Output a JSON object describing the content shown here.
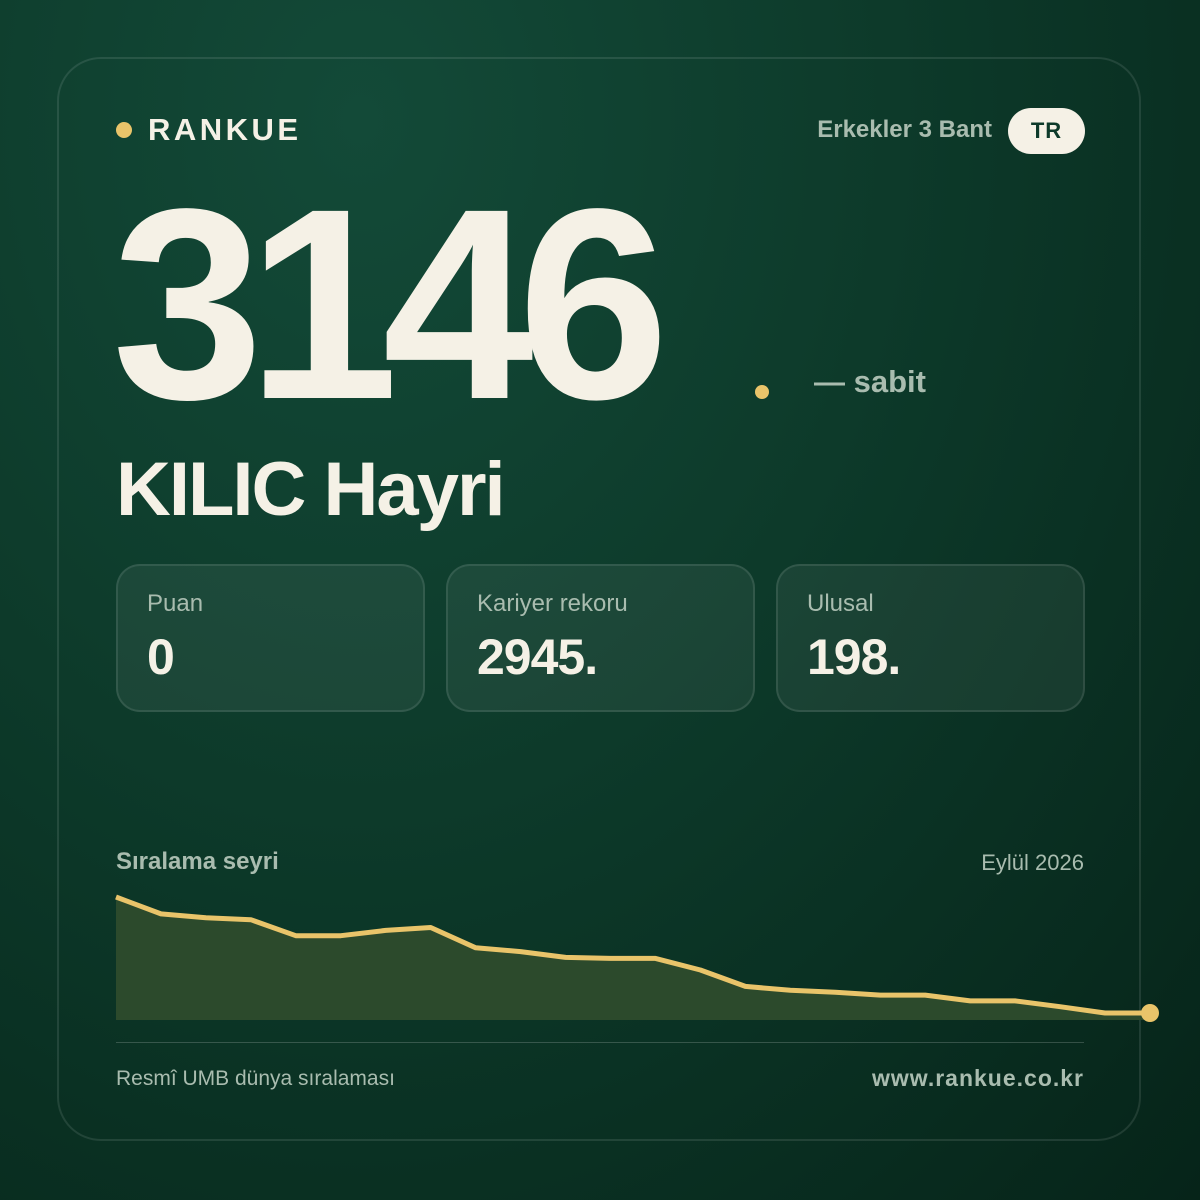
{
  "brand": {
    "name": "RANKUE",
    "dot_color": "#e9c46a"
  },
  "header": {
    "category": "Erkekler 3 Bant",
    "country": "TR"
  },
  "player": {
    "rank": "3146",
    "trend": "— sabit",
    "name": "KILIC Hayri"
  },
  "stats": [
    {
      "label": "Puan",
      "value": "0"
    },
    {
      "label": "Kariyer rekoru",
      "value": "2945."
    },
    {
      "label": "Ulusal",
      "value": "198."
    }
  ],
  "chart": {
    "title": "Sıralama seyri",
    "date": "Eylül 2026"
  },
  "chart_data": {
    "type": "area",
    "title": "Sıralama seyri",
    "series": [
      {
        "values": [
          2945,
          2980,
          2988,
          2992,
          3025,
          3025,
          3014,
          3008,
          3050,
          3058,
          3070,
          3072,
          3072,
          3096,
          3130,
          3138,
          3142,
          3148,
          3148,
          3160,
          3160,
          3172,
          3185,
          3185
        ]
      }
    ],
    "y_inverted": true,
    "line_color": "#e9c46a",
    "fill_color": "#2c4a2c",
    "grid": false,
    "legend": "none"
  },
  "footer": {
    "left": "Resmî UMB dünya sıralaması",
    "right": "www.rankue.co.kr"
  },
  "colors": {
    "background": "#0d3a2a",
    "accent": "#e9c46a",
    "text": "#f5f1e6",
    "muted": "#a9bcaf"
  }
}
